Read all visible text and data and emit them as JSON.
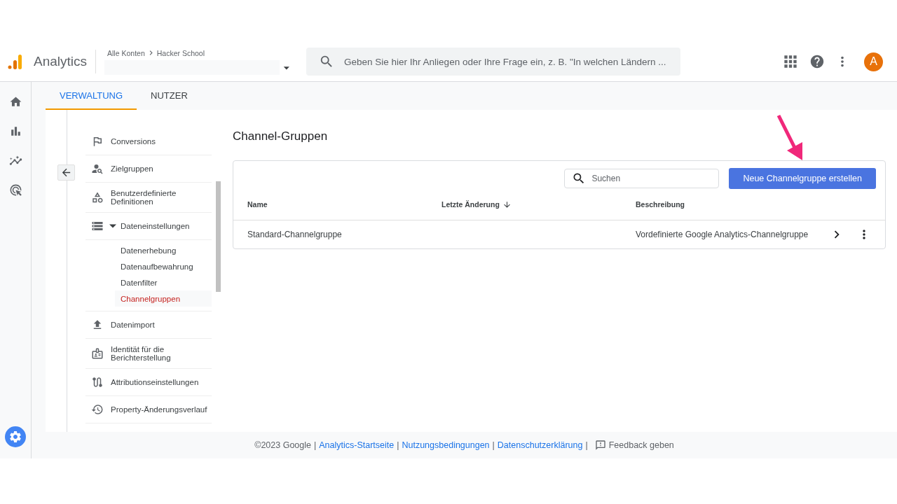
{
  "header": {
    "product": "Analytics",
    "breadcrumb": [
      "Alle Konten",
      "Hacker School"
    ],
    "search": {
      "placeholder": "Geben Sie hier Ihr Anliegen oder Ihre Frage ein, z. B. \"In welchen Ländern ..."
    },
    "avatar": "A"
  },
  "rail": [
    {
      "selected": false
    },
    {
      "selected": false
    },
    {
      "selected": false
    },
    {
      "selected": false
    },
    {
      "selected": true
    }
  ],
  "tabs": [
    {
      "label": "VERWALTUNG",
      "selected": true
    },
    {
      "label": "NUTZER",
      "selected": false
    }
  ],
  "nav": [
    {
      "label": "Conversions"
    },
    {
      "label": "Zielgruppen"
    },
    {
      "label": "Benutzerdefinierte Definitionen"
    },
    {
      "label": "Dateneinstellungen",
      "expanded": true,
      "children": [
        {
          "label": "Datenerhebung",
          "selected": false
        },
        {
          "label": "Datenaufbewahrung",
          "selected": false
        },
        {
          "label": "Datenfilter",
          "selected": false
        },
        {
          "label": "Channelgruppen",
          "selected": true
        }
      ]
    },
    {
      "label": "Datenimport"
    },
    {
      "label": "Identität für die Berichterstellung"
    },
    {
      "label": "Attributionseinstellungen"
    },
    {
      "label": "Property-Änderungsverlauf"
    }
  ],
  "page": {
    "title": "Channel-Gruppen",
    "search": {
      "placeholder": "Suchen"
    },
    "create_button": "Neue Channelgruppe erstellen",
    "columns": [
      "Name",
      "Letzte Änderung",
      "Beschreibung"
    ],
    "rows": [
      {
        "name": "Standard-Channelgruppe",
        "description": "Vordefinierte Google Analytics-Channelgruppe"
      }
    ]
  },
  "footer": {
    "copyright": "©2023 Google",
    "separator": "|",
    "links": [
      "Analytics-Startseite",
      "Nutzungsbedingungen",
      "Datenschutzerklärung"
    ],
    "feedback": "Feedback geben"
  }
}
